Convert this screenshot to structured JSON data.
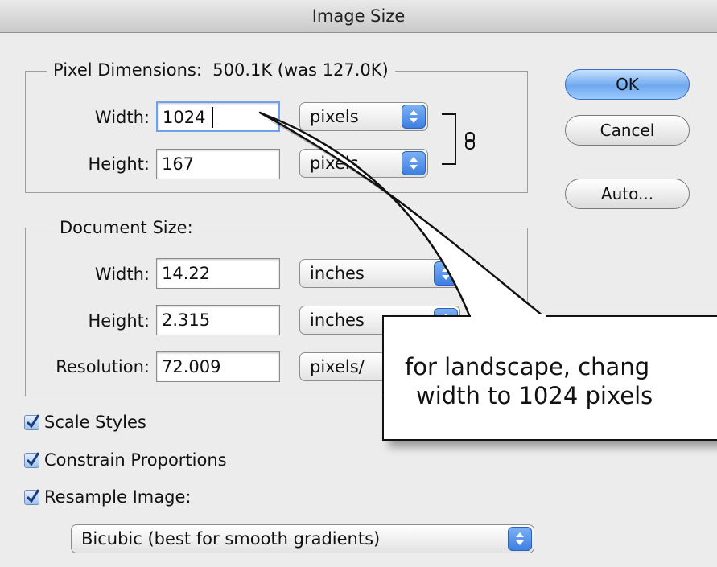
{
  "window": {
    "title": "Image Size"
  },
  "pixel_dimensions": {
    "legend": "Pixel Dimensions:  500.1K (was 127.0K)",
    "width_label": "Width:",
    "width_value": "1024",
    "width_unit": "pixels",
    "height_label": "Height:",
    "height_value": "167",
    "height_unit": "pixels",
    "link_icon": "chain-link-icon"
  },
  "document_size": {
    "legend": "Document Size:",
    "width_label": "Width:",
    "width_value": "14.22",
    "width_unit": "inches",
    "height_label": "Height:",
    "height_value": "2.315",
    "height_unit": "inches",
    "resolution_label": "Resolution:",
    "resolution_value": "72.009",
    "resolution_unit": "pixels/"
  },
  "buttons": {
    "ok": "OK",
    "cancel": "Cancel",
    "auto": "Auto..."
  },
  "checkboxes": [
    {
      "label": "Scale Styles",
      "checked": true
    },
    {
      "label": "Constrain Proportions",
      "checked": true
    },
    {
      "label": "Resample Image:",
      "checked": true
    }
  ],
  "resample_method": "Bicubic (best for smooth gradients)",
  "callout": {
    "line1": "for landscape, chang",
    "line2": "width to 1024 pixels"
  },
  "colors": {
    "accent": "#5b9cf0",
    "callout_border": "#111111"
  }
}
